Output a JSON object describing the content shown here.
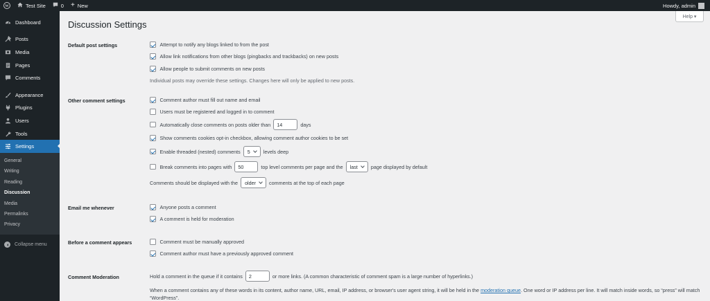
{
  "adminbar": {
    "site_name": "Test Site",
    "comments_count": "0",
    "new_label": "New",
    "howdy": "Howdy, admin"
  },
  "help_label": "Help ▾",
  "sidebar": {
    "items": [
      {
        "label": "Dashboard",
        "icon": "dashboard-icon"
      },
      {
        "label": "Posts",
        "icon": "pin-icon"
      },
      {
        "label": "Media",
        "icon": "media-icon"
      },
      {
        "label": "Pages",
        "icon": "page-icon"
      },
      {
        "label": "Comments",
        "icon": "comment-icon"
      },
      {
        "label": "Appearance",
        "icon": "brush-icon"
      },
      {
        "label": "Plugins",
        "icon": "plugin-icon"
      },
      {
        "label": "Users",
        "icon": "user-icon"
      },
      {
        "label": "Tools",
        "icon": "wrench-icon"
      },
      {
        "label": "Settings",
        "icon": "settings-icon"
      }
    ],
    "submenu": [
      "General",
      "Writing",
      "Reading",
      "Discussion",
      "Media",
      "Permalinks",
      "Privacy"
    ],
    "collapse_label": "Collapse menu"
  },
  "page": {
    "title": "Discussion Settings",
    "sections": {
      "default_post": {
        "label": "Default post settings",
        "opt1": "Attempt to notify any blogs linked to from the post",
        "opt2": "Allow link notifications from other blogs (pingbacks and trackbacks) on new posts",
        "opt3": "Allow people to submit comments on new posts",
        "note": "Individual posts may override these settings. Changes here will only be applied to new posts."
      },
      "other_comment": {
        "label": "Other comment settings",
        "opt1": "Comment author must fill out name and email",
        "opt2": "Users must be registered and logged in to comment",
        "opt3_before": "Automatically close comments on posts older than",
        "opt3_value": "14",
        "opt3_after": "days",
        "opt4": "Show comments cookies opt-in checkbox, allowing comment author cookies to be set",
        "opt5_before": "Enable threaded (nested) comments",
        "opt5_value": "5",
        "opt5_after": "levels deep",
        "opt6_before": "Break comments into pages with",
        "opt6_value": "50",
        "opt6_mid": "top level comments per page and the",
        "opt6_select": "last",
        "opt6_after": "page displayed by default",
        "order_before": "Comments should be displayed with the",
        "order_select": "older",
        "order_after": "comments at the top of each page"
      },
      "email_me": {
        "label": "Email me whenever",
        "opt1": "Anyone posts a comment",
        "opt2": "A comment is held for moderation"
      },
      "before_appears": {
        "label": "Before a comment appears",
        "opt1": "Comment must be manually approved",
        "opt2": "Comment author must have a previously approved comment"
      },
      "moderation": {
        "label": "Comment Moderation",
        "hold_before": "Hold a comment in the queue if it contains",
        "hold_value": "2",
        "hold_after": "or more links. (A common characteristic of comment spam is a large number of hyperlinks.)",
        "desc_before": "When a comment contains any of these words in its content, author name, URL, email, IP address, or browser's user agent string, it will be held in the",
        "desc_link": "moderation queue",
        "desc_after": ". One word or IP address per line. It will match inside words, so “press” will match “WordPress”."
      }
    }
  },
  "colors": {
    "adminbar_bg": "#1d2327",
    "accent": "#2271b1",
    "page_bg": "#f0f0f1"
  }
}
